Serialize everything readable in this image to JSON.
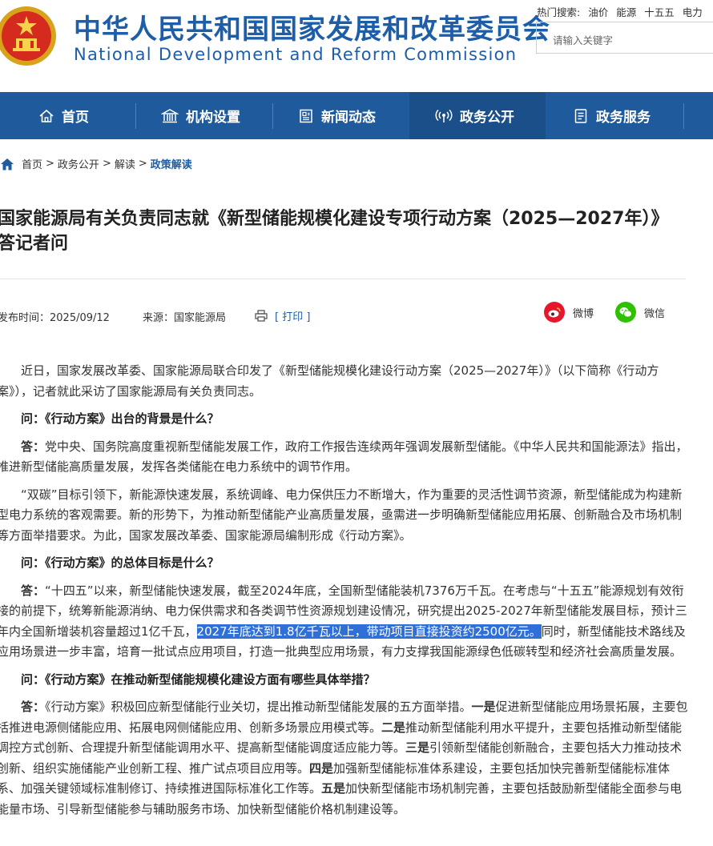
{
  "header": {
    "title_cn": "中华人民共和国国家发展和改革委员会",
    "title_en": "National Development and Reform Commission",
    "hot_label": "热门搜索:",
    "hot_keywords": [
      "油价",
      "能源",
      "十五五",
      "电力"
    ],
    "search_placeholder": "请输入关键字"
  },
  "nav": {
    "items": [
      {
        "label": "首页",
        "icon": "home-icon"
      },
      {
        "label": "机构设置",
        "icon": "building-icon"
      },
      {
        "label": "新闻动态",
        "icon": "news-icon"
      },
      {
        "label": "政务公开",
        "icon": "broadcast-icon"
      },
      {
        "label": "政务服务",
        "icon": "document-icon"
      }
    ],
    "active_index": 3
  },
  "breadcrumb": {
    "items": [
      "首页",
      "政务公开",
      "解读"
    ],
    "current": "政策解读",
    "separator": ">"
  },
  "article": {
    "title": "国家能源局有关负责同志就《新型储能规模化建设专项行动方案（2025—2027年）》答记者问",
    "publish_label": "发布时间：",
    "publish_date": "2025/09/12",
    "source_label": "来源：",
    "source": "国家能源局",
    "print_label": "[ 打印 ]",
    "share": {
      "weibo": "微博",
      "wechat": "微信"
    },
    "paragraphs": [
      {
        "type": "text",
        "text": "近日，国家发展改革委、国家能源局联合印发了《新型储能规模化建设行动方案（2025—2027年）》（以下简称《行动方案》），记者就此采访了国家能源局有关负责同志。"
      },
      {
        "type": "question",
        "text": "问：《行动方案》出台的背景是什么？"
      },
      {
        "type": "answer",
        "lead": "答：",
        "text": "党中央、国务院高度重视新型储能发展工作，政府工作报告连续两年强调发展新型储能。《中华人民共和国能源法》指出，推进新型储能高质量发展，发挥各类储能在电力系统中的调节作用。"
      },
      {
        "type": "text",
        "text": "“双碳”目标引领下，新能源快速发展，系统调峰、电力保供压力不断增大，作为重要的灵活性调节资源，新型储能成为构建新型电力系统的客观需要。新的形势下，为推动新型储能产业高质量发展，亟需进一步明确新型储能应用拓展、创新融合及市场机制等方面举措要求。为此，国家发展改革委、国家能源局编制形成《行动方案》。"
      },
      {
        "type": "question",
        "text": "问：《行动方案》的总体目标是什么？"
      },
      {
        "type": "answer_hl",
        "lead": "答：",
        "before": "“十四五”以来，新型储能快速发展，截至2024年底，全国新型储能装机7376万千瓦。在考虑与“十五五”能源规划有效衔接的前提下，统筹新能源消纳、电力保供需求和各类调节性资源规划建设情况，研究提出2025-2027年新型储能发展目标，预计三年内全国新增装机容量超过1亿千瓦，",
        "highlight": "2027年底达到1.8亿千瓦以上，带动项目直接投资约2500亿元。",
        "after": "同时，新型储能技术路线及应用场景进一步丰富，培育一批试点应用项目，打造一批典型应用场景，有力支撑我国能源绿色低碳转型和经济社会高质量发展。"
      },
      {
        "type": "question",
        "text": "问：《行动方案》在推动新型储能规模化建设方面有哪些具体举措？"
      },
      {
        "type": "answer_list",
        "lead": "答：",
        "intro": "《行动方案》积极回应新型储能行业关切，提出推动新型储能发展的五方面举措。",
        "points": [
          {
            "head": "一是",
            "text": "促进新型储能应用场景拓展，主要包括推进电源侧储能应用、拓展电网侧储能应用、创新多场景应用模式等。"
          },
          {
            "head": "二是",
            "text": "推动新型储能利用水平提升，主要包括推动新型储能调控方式创新、合理提升新型储能调用水平、提高新型储能调度适应能力等。"
          },
          {
            "head": "三是",
            "text": "引领新型储能创新融合，主要包括大力推动技术创新、组织实施储能产业创新工程、推广试点项目应用等。"
          },
          {
            "head": "四是",
            "text": "加强新型储能标准体系建设，主要包括加快完善新型储能标准体系、加强关键领域标准制修订、持续推进国际标准化工作等。"
          },
          {
            "head": "五是",
            "text": "加快新型储能市场机制完善，主要包括鼓励新型储能全面参与电能量市场、引导新型储能参与辅助服务市场、加快新型储能价格机制建设等。"
          }
        ]
      }
    ]
  },
  "colors": {
    "brand_blue": "#1e5ea8",
    "nav_bg": "#1f5b9c",
    "highlight": "#2f6fd8",
    "weibo": "#e6162d",
    "wechat": "#2dc100"
  }
}
